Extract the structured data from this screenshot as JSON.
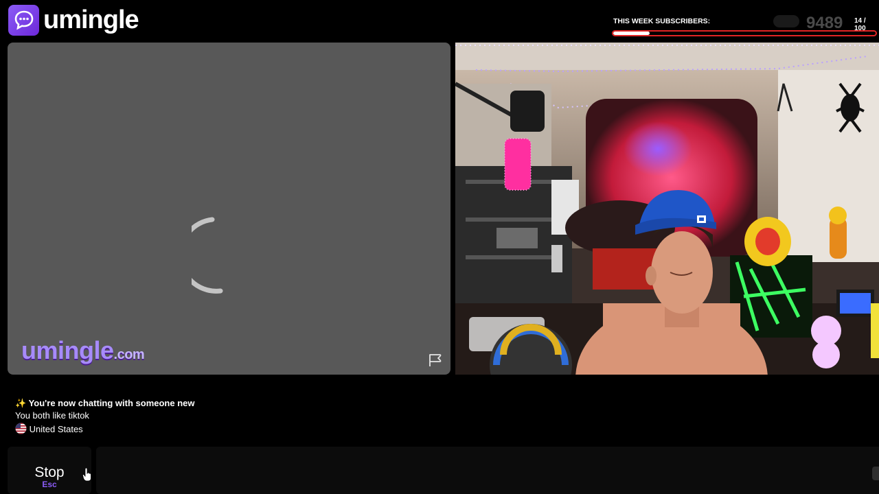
{
  "brand": {
    "name": "umingle",
    "icon": "chat-bubble-icon",
    "accent": "#8b5cf6"
  },
  "subscribers": {
    "label": "THIS WEEK SUBSCRIBERS:",
    "number": "9489",
    "count": "14 / 100",
    "progress": 0.14,
    "bar_color": "#e02525"
  },
  "stranger_video": {
    "watermark_name": "umingle",
    "watermark_domain": ".com",
    "status": "loading",
    "report_icon": "flag-icon"
  },
  "chat": {
    "lines": {
      "now_chatting": "You're now chatting with someone new",
      "common_interest": "You both like tiktok",
      "country": "United States"
    },
    "sparkle_icon": "sparkles-icon",
    "country_flag_icon": "us-flag-icon"
  },
  "controls": {
    "stop_label": "Stop",
    "stop_key": "Esc",
    "message_placeholder": ""
  }
}
